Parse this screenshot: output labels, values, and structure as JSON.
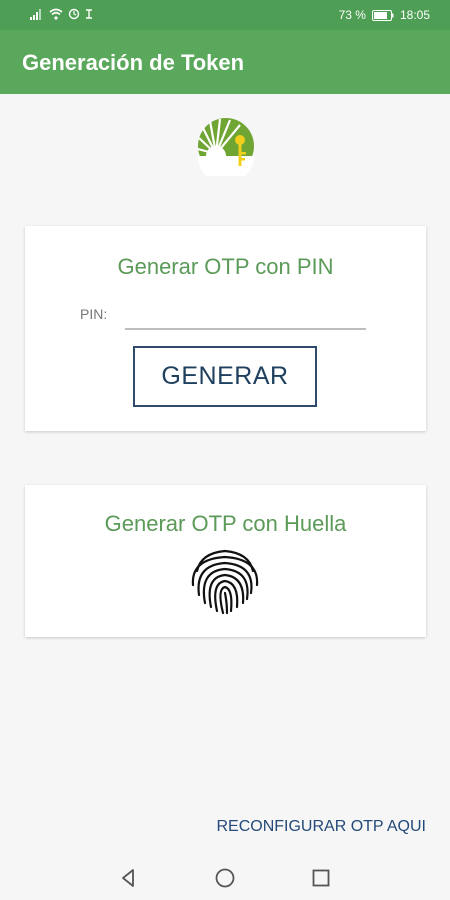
{
  "status_bar": {
    "battery_percent": "73 %",
    "time": "18:05",
    "icons": [
      "signal-icon",
      "wifi-icon",
      "sync-icon",
      "notification-icon",
      "battery-icon"
    ]
  },
  "app_bar": {
    "title": "Generación de Token"
  },
  "logo": {
    "icon": "sun-key-logo-icon"
  },
  "pin_card": {
    "title": "Generar OTP con PIN",
    "pin_label": "PIN:",
    "pin_value": "",
    "pin_placeholder": "",
    "generate_label": "GENERAR"
  },
  "fingerprint_card": {
    "title": "Generar OTP con Huella",
    "icon": "fingerprint-icon"
  },
  "reconfigure_link": "RECONFIGURAR OTP AQUI",
  "nav_bar": {
    "buttons": [
      "back-icon",
      "home-icon",
      "recents-icon"
    ]
  },
  "colors": {
    "primary": "#5aa85b",
    "status_bar": "#4f9e55",
    "card_title": "#5b9a58",
    "button_border": "#2e4a6c",
    "link": "#234a78"
  }
}
